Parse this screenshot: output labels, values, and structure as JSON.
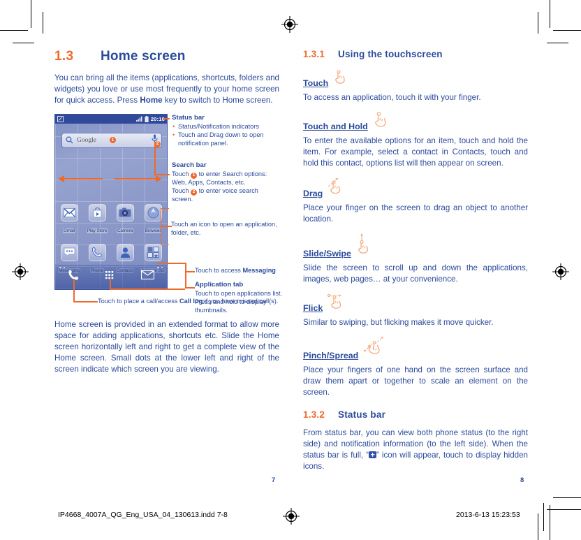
{
  "left": {
    "heading": {
      "num": "1.3",
      "text": "Home screen"
    },
    "intro_1": "You can bring all the items (applications, shortcuts, folders and widgets) you love or use most frequently to your home screen for quick access. Press ",
    "intro_bold": "Home",
    "intro_2": " key to switch to Home screen.",
    "outro": "Home screen is provided in an extended format to allow more space for adding applications, shortcuts etc. Slide the Home screen horizontally left and right to get a complete view of the Home screen. Small dots at the lower left and right of the screen indicate which screen you are viewing."
  },
  "phone": {
    "status_time": "20:16",
    "search_text": "Google",
    "badge_1": "1",
    "badge_2": "2",
    "apps_row1": [
      {
        "label": "Gmail",
        "icon": "gmail-icon"
      },
      {
        "label": "Play Store",
        "icon": "play-store-icon"
      },
      {
        "label": "Camera",
        "icon": "camera-icon"
      },
      {
        "label": "Browser",
        "icon": "browser-icon"
      }
    ],
    "apps_row2": [
      {
        "label": "Messaging",
        "icon": "messaging-icon"
      },
      {
        "label": "Phone",
        "icon": "phone-icon"
      },
      {
        "label": "Contacts",
        "icon": "contacts-icon"
      },
      {
        "label": "Apps on SD",
        "icon": "apps-on-sd-icon"
      }
    ],
    "dock": [
      {
        "name": "dock-phone-icon"
      },
      {
        "name": "dock-app-drawer-icon"
      },
      {
        "name": "dock-messaging-icon"
      }
    ]
  },
  "callouts": {
    "status_bar": {
      "title": "Status bar",
      "items": [
        "Status/Notification indicators",
        "Touch and Drag down to open notification panel."
      ]
    },
    "search_bar": {
      "title": "Search bar",
      "line1_a": "Touch ",
      "line1_badge": "1",
      "line1_b": " to enter Search options:",
      "line2": "Web, Apps, Contacts, etc.",
      "line3_a": "Touch ",
      "line3_badge": "2",
      "line3_b": " to enter voice search",
      "line4": "screen."
    },
    "icon_note": "Touch an icon to open an application, folder, etc.",
    "messaging_a": "Touch to access ",
    "messaging_b": "Messaging",
    "app_tab_title": "Application tab",
    "app_tab_line1": "Touch to open applications list.",
    "app_tab_line2": "Press and hold to display thumbnails.",
    "call_log_a": "Touch to place a call/access ",
    "call_log_b": "Call log",
    "call_log_c": " if you have missed call(s)."
  },
  "right": {
    "heading_1": {
      "num": "1.3.1",
      "text": "Using the touchscreen"
    },
    "sections": [
      {
        "title": "Touch",
        "icon": "touch-hand-icon",
        "body": "To access an application, touch it with your finger."
      },
      {
        "title": "Touch and Hold",
        "icon": "touch-hold-hand-icon",
        "body": "To enter the available options for an item, touch and hold the item. For example, select a contact in Contacts, touch and hold this contact, options list will then appear on screen."
      },
      {
        "title": "Drag",
        "icon": "drag-hand-icon",
        "body": "Place your finger on the screen to drag an object to another location."
      },
      {
        "title": "Slide/Swipe",
        "icon": "slide-hand-icon",
        "body": "Slide the screen to scroll up and down the applications, images, web pages… at your convenience."
      },
      {
        "title": "Flick",
        "icon": "flick-hand-icon",
        "body": "Similar to swiping, but flicking makes it move quicker."
      },
      {
        "title": "Pinch/Spread",
        "icon": "pinch-spread-hand-icon",
        "body": "Place your fingers of one hand on the screen surface and draw them apart or together to scale an element on the screen."
      }
    ],
    "heading_2": {
      "num": "1.3.2",
      "text": "Status bar"
    },
    "status_body_a": "From status bar, you can view both phone status (to the right side) and notification information (to the left side). When the status bar is full, “",
    "status_body_b": "” icon will appear, touch to display hidden icons."
  },
  "footer": {
    "page_left": "7",
    "page_right": "8",
    "filename": "IP4668_4007A_QG_Eng_USA_04_130613.indd   7-8",
    "datetime": "2013-6-13   15:23:53"
  },
  "colors": {
    "accent_orange": "#ED6A2C",
    "text_blue": "#2b4a9b",
    "status_blue": "#31499a"
  }
}
